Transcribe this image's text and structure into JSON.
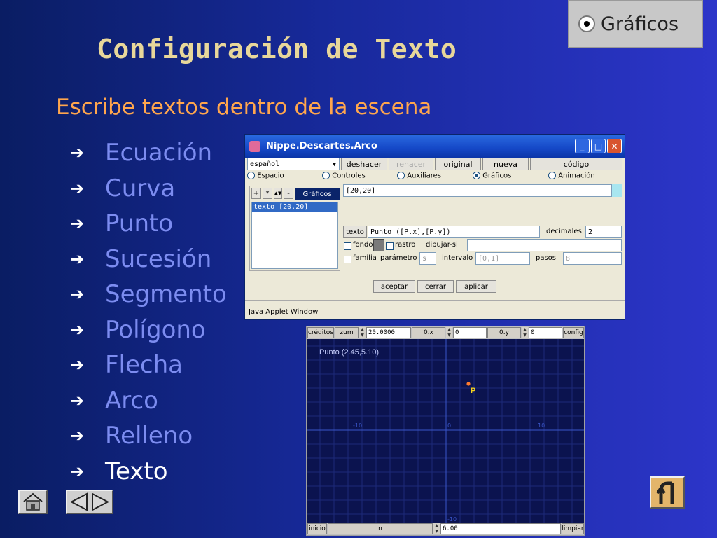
{
  "badge": {
    "label": "Gráficos",
    "icon": "radio-selected-icon"
  },
  "page_title": "Configuración de Texto",
  "subtitle": "Escribe textos dentro de la escena",
  "topics": [
    {
      "label": "Ecuación"
    },
    {
      "label": "Curva"
    },
    {
      "label": "Punto"
    },
    {
      "label": "Sucesión"
    },
    {
      "label": "Segmento"
    },
    {
      "label": "Polígono"
    },
    {
      "label": "Flecha"
    },
    {
      "label": "Arco"
    },
    {
      "label": "Relleno"
    },
    {
      "label": "Texto"
    }
  ],
  "active_topic": "Texto",
  "applet": {
    "title": "Nippe.Descartes.Arco",
    "language": "español",
    "toolbar": {
      "deshacer": "deshacer",
      "rehacer": "rehacer",
      "original": "original",
      "nueva": "nueva",
      "codigo": "código"
    },
    "tabs": [
      "Espacio",
      "Controles",
      "Auxiliares",
      "Gráficos",
      "Animación"
    ],
    "selected_tab": "Gráficos",
    "list_header": "Gráficos",
    "list_buttons": [
      "+",
      "*",
      "-"
    ],
    "list_items": [
      "texto [20,20]"
    ],
    "position_value": "[20,20]",
    "texto_button": "texto",
    "texto_value": "Punto ([P.x],[P.y])",
    "decimales_label": "decimales",
    "decimales_value": "2",
    "fondo_label": "fondo",
    "rastro_label": "rastro",
    "dibujar_si_label": "dibujar-si",
    "dibujar_si_value": "",
    "familia_label": "familia",
    "parametro_label": "parámetro",
    "parametro_value": "s",
    "intervalo_label": "intervalo",
    "intervalo_value": "[0,1]",
    "pasos_label": "pasos",
    "pasos_value": "8",
    "aceptar": "aceptar",
    "cerrar": "cerrar",
    "aplicar": "aplicar",
    "status": "Java Applet Window",
    "colors": {
      "titlebar": "#1548c7",
      "face": "#ece9d8"
    }
  },
  "scene": {
    "creditos": "créditos",
    "zum_label": "zum",
    "zum_value": "20.0000",
    "ox_label": "0.x",
    "ox_value": "0",
    "oy_label": "0.y",
    "oy_value": "0",
    "config": "config",
    "point_text": "Punto (2.45,5.10)",
    "point_label": "P",
    "axis_neg10": "-10",
    "axis_0": "0",
    "axis_10": "10",
    "axis_y_neg10": "-10",
    "inicio": "inicio",
    "n_label": "n",
    "n_value": "6.00",
    "limpiar": "limpiar",
    "colors": {
      "background": "#0b134f",
      "grid": "#1c2a78",
      "axis": "#3a55c8",
      "point": "#ff7b2e",
      "point_label": "#f5d21e"
    }
  },
  "nav": {
    "home": "home-icon",
    "prev": "prev-arrow-icon",
    "next": "next-arrow-icon",
    "return": "return-icon"
  }
}
